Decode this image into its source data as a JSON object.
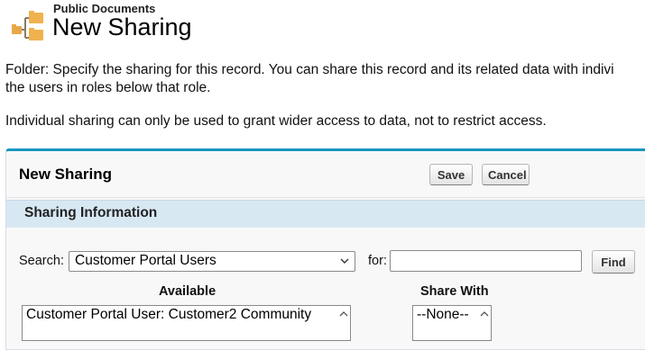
{
  "header": {
    "subtitle": "Public Documents",
    "title": "New Sharing",
    "icon": "folder-sharing-icon"
  },
  "description": {
    "line1": "Folder: Specify the sharing for this record. You can share this record and its related data with indivi",
    "line2": "the users in roles below that role.",
    "line3": "Individual sharing can only be used to grant wider access to data, not to restrict access."
  },
  "panel": {
    "title": "New Sharing",
    "save_label": "Save",
    "cancel_label": "Cancel",
    "accent_color": "#1797c0"
  },
  "section": {
    "title": "Sharing Information",
    "background_color": "#d8e8f3"
  },
  "search": {
    "label": "Search:",
    "selected": "Customer Portal Users",
    "for_label": "for:",
    "for_value": "",
    "find_label": "Find"
  },
  "available": {
    "heading": "Available",
    "items": [
      "Customer Portal User: Customer2 Community"
    ]
  },
  "share_with": {
    "heading": "Share With",
    "items": [
      "--None--"
    ]
  }
}
